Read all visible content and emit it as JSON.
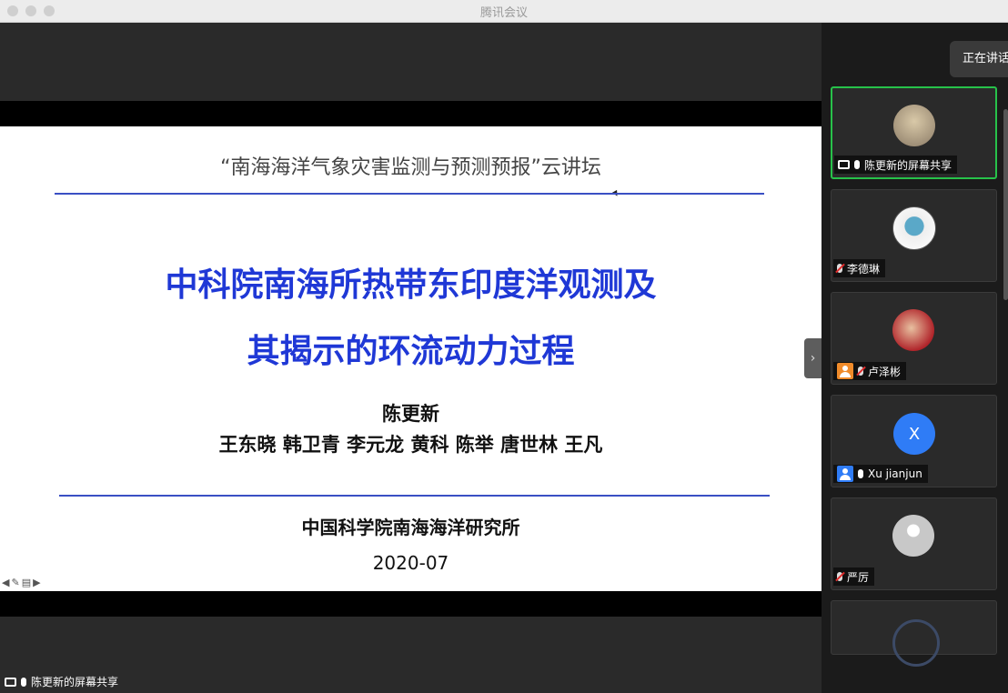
{
  "window": {
    "title": "腾讯会议"
  },
  "slide": {
    "subtitle": "“南海海洋气象灾害监测与预测预报”云讲坛",
    "title_line1": "中科院南海所热带东印度洋观测及",
    "title_line2": "其揭示的环流动力过程",
    "presenter": "陈更新",
    "coauthors": "王东晓 韩卫青 李元龙  黄科 陈举 唐世林 王凡",
    "institution": "中国科学院南海海洋研究所",
    "date": "2020-07"
  },
  "share_bar": {
    "label": "陈更新的屏幕共享"
  },
  "panel": {
    "speaking_label": "正在讲话",
    "participants": [
      {
        "name": "陈更新的屏幕共享",
        "avatar": "photo",
        "mic": "on",
        "active": true
      },
      {
        "name": "李德琳",
        "avatar": "photo",
        "mic": "muted"
      },
      {
        "name": "卢泽彬",
        "avatar": "photo",
        "mic": "muted"
      },
      {
        "name": "Xu jianjun",
        "avatar_letter": "X",
        "mic": "on"
      },
      {
        "name": "严厉",
        "avatar": "default",
        "mic": "muted"
      }
    ]
  },
  "colors": {
    "title_blue": "#1f38d6",
    "active_border": "#27c24a",
    "accent_blue": "#2f7cf6"
  }
}
